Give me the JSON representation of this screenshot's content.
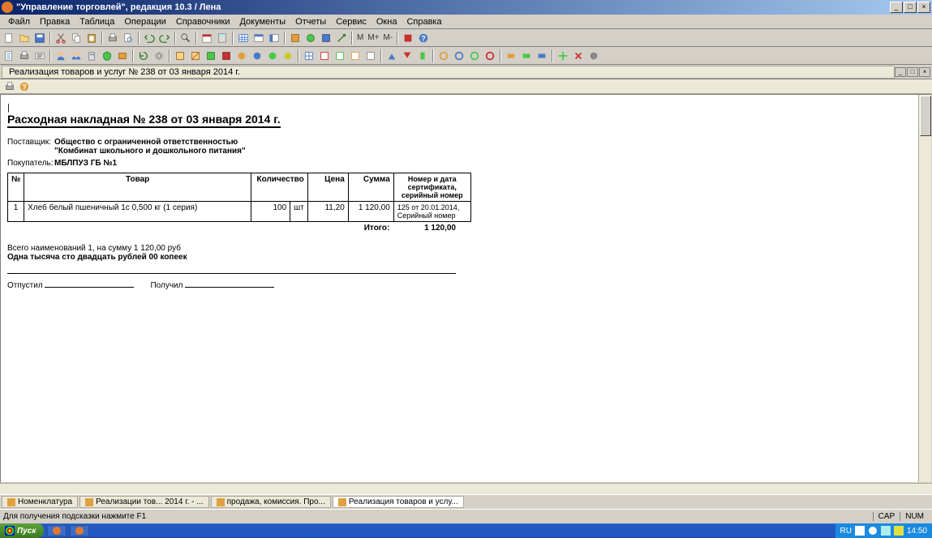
{
  "titlebar": {
    "text": "\"Управление торговлей\", редакция 10.3 / Лена"
  },
  "menu": {
    "items": [
      "Файл",
      "Правка",
      "Таблица",
      "Операции",
      "Справочники",
      "Документы",
      "Отчеты",
      "Сервис",
      "Окна",
      "Справка"
    ]
  },
  "toolbar_text": {
    "m": "M",
    "mplus": "M+",
    "mminus": "M-"
  },
  "doc_tab": {
    "label": "Реализация товаров и услуг № 238 от 03 января 2014 г."
  },
  "document": {
    "title": "Расходная накладная № 238 от 03 января 2014 г.",
    "supplier_label": "Поставщик:",
    "supplier": "Общество с ограниченной ответственностью \"Комбинат школьного и дошкольного питания\"",
    "buyer_label": "Покупатель:",
    "buyer": "МБЛПУЗ ГБ №1",
    "table": {
      "headers": {
        "num": "№",
        "product": "Товар",
        "qty": "Количество",
        "price": "Цена",
        "sum": "Сумма",
        "cert": "Номер и дата сертификата, серийный номер"
      },
      "rows": [
        {
          "num": "1",
          "product": "Хлеб белый пшеничный 1с   0,500 кг (1 серия)",
          "qty": "100",
          "unit": "шт",
          "price": "11,20",
          "sum": "1 120,00",
          "cert": "125 от 20.01.2014, Серийный номер"
        }
      ]
    },
    "total_label": "Итого:",
    "total_value": "1 120,00",
    "summary_line": "Всего наименований 1, на сумму 1 120,00 руб",
    "summary_words": "Одна тысяча сто двадцать рублей 00 копеек",
    "sign_left": "Отпустил",
    "sign_right": "Получил"
  },
  "bottom_tabs": {
    "items": [
      "Номенклатура",
      "Реализации тов... 2014 г. - ...",
      "продажа, комиссия. Про...",
      "Реализация товаров и услу..."
    ]
  },
  "statusbar": {
    "hint": "Для получения подсказки нажмите F1",
    "cap": "CAP",
    "num": "NUM"
  },
  "taskbar": {
    "start": "Пуск",
    "lang": "RU",
    "time": "14:50"
  }
}
